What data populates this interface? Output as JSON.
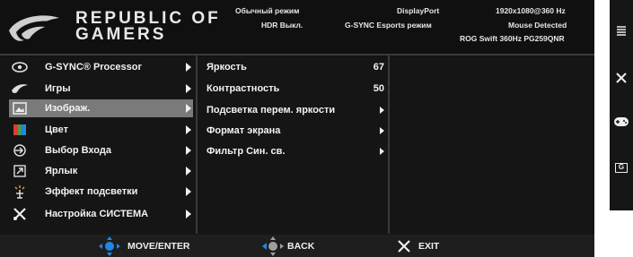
{
  "header": {
    "brand_line1": "REPUBLIC OF",
    "brand_line2": "GAMERS",
    "mode": "Обычный режим",
    "hdr": "HDR Выкл.",
    "input": "DisplayPort",
    "gsync": "G-SYNC Esports режим",
    "resolution": "1920x1080@360 Hz",
    "mouse": "Mouse Detected",
    "model": "ROG Swift 360Hz PG259QNR"
  },
  "menu": {
    "items": [
      {
        "label": "G-SYNC® Processor",
        "icon": "gsync-icon"
      },
      {
        "label": "Игры",
        "icon": "rog-icon"
      },
      {
        "label": "Изображ.",
        "icon": "image-icon",
        "selected": true
      },
      {
        "label": "Цвет",
        "icon": "color-icon"
      },
      {
        "label": "Выбор Входа",
        "icon": "input-icon"
      },
      {
        "label": "Ярлык",
        "icon": "shortcut-icon"
      },
      {
        "label": "Эффект подсветки",
        "icon": "light-icon"
      },
      {
        "label": "Настройка СИСТЕМА",
        "icon": "tools-icon"
      }
    ]
  },
  "submenu": {
    "items": [
      {
        "label": "Яркость",
        "value": "67"
      },
      {
        "label": "Контрастность",
        "value": "50"
      },
      {
        "label": "Подсветка перем. яркости",
        "value": ""
      },
      {
        "label": "Формат экрана",
        "value": ""
      },
      {
        "label": "Фильтр Син. св.",
        "value": ""
      }
    ]
  },
  "footer": {
    "move_enter": "MOVE/ENTER",
    "back": "BACK",
    "exit": "EXIT"
  },
  "side_panel": {
    "icons": [
      "menu-icon",
      "close-icon",
      "gamepad-icon",
      "gameplus-icon"
    ],
    "g_label": "G"
  }
}
